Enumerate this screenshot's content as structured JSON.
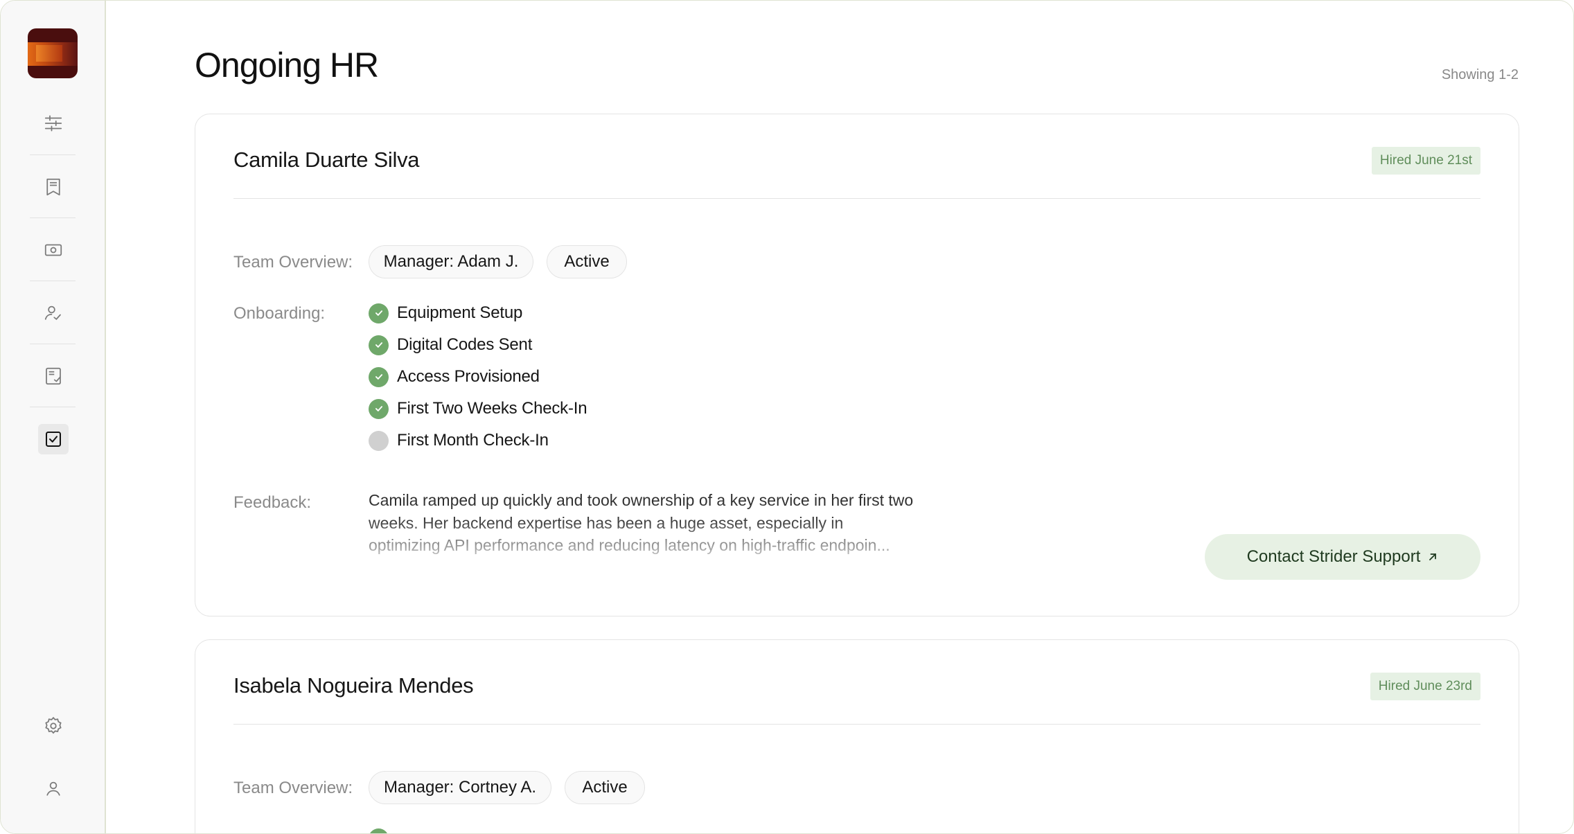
{
  "page": {
    "title": "Ongoing HR",
    "showing": "Showing 1-2"
  },
  "sidebar": {
    "logo": "app-logo",
    "items": [
      {
        "icon": "sliders-icon",
        "active": false
      },
      {
        "icon": "bookmark-receipt-icon",
        "active": false
      },
      {
        "icon": "money-icon",
        "active": false
      },
      {
        "icon": "user-check-icon",
        "active": false
      },
      {
        "icon": "document-check-icon",
        "active": false
      },
      {
        "icon": "checkbox-icon",
        "active": true
      }
    ],
    "bottom_items": [
      {
        "icon": "gear-icon"
      },
      {
        "icon": "user-icon"
      }
    ]
  },
  "cards": [
    {
      "name": "Camila Duarte Silva",
      "hired": "Hired June 21st",
      "team_label": "Team Overview:",
      "manager": "Manager: Adam J.",
      "status": "Active",
      "onboarding_label": "Onboarding:",
      "onboarding": [
        {
          "label": "Equipment Setup",
          "done": true
        },
        {
          "label": "Digital Codes Sent",
          "done": true
        },
        {
          "label": "Access Provisioned",
          "done": true
        },
        {
          "label": "First Two Weeks Check-In",
          "done": true
        },
        {
          "label": "First Month Check-In",
          "done": false
        }
      ],
      "feedback_label": "Feedback:",
      "feedback": "Camila ramped up quickly and took ownership of a key service in her first two weeks. Her backend expertise has been a huge asset, especially in optimizing API performance and reducing latency on high-traffic endpoin...",
      "support_button": "Contact Strider Support"
    },
    {
      "name": "Isabela Nogueira Mendes",
      "hired": "Hired June 23rd",
      "team_label": "Team Overview:",
      "manager": "Manager: Cortney A.",
      "status": "Active"
    }
  ],
  "colors": {
    "accent_green": "#6fa86a",
    "badge_bg": "#e6f1e4",
    "badge_text": "#5f8d5a"
  }
}
